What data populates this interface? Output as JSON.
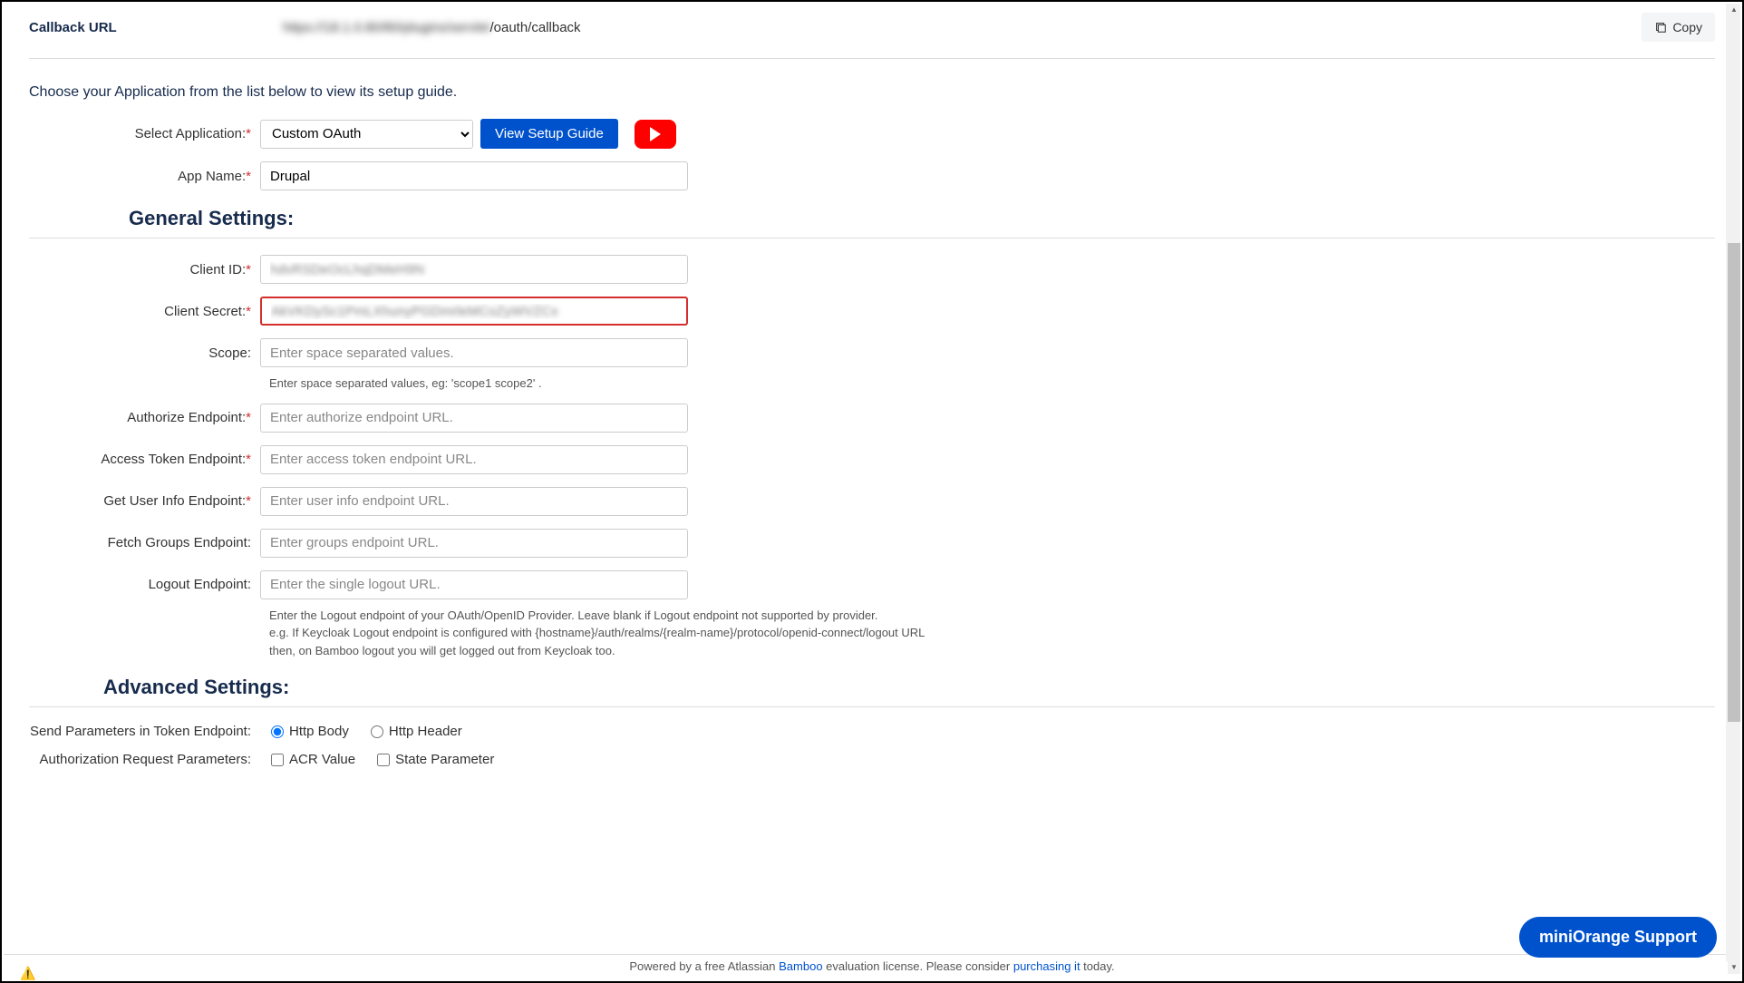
{
  "callback": {
    "label": "Callback URL",
    "url_blurred": "https://18.1.0.80/80/plugins/servlet",
    "url_suffix": "/oauth/callback",
    "copy_label": "Copy"
  },
  "intro": "Choose your Application from the list below to view its setup guide.",
  "select_app": {
    "label": "Select Application:",
    "value": "Custom OAuth"
  },
  "view_setup_btn": "View Setup Guide",
  "app_name": {
    "label": "App Name:",
    "value": "Drupal"
  },
  "general_heading": "General Settings:",
  "client_id": {
    "label": "Client ID:",
    "value": "hdvRSDeOcLhqDMeH9N"
  },
  "client_secret": {
    "label": "Client Secret:",
    "value": "AkVKDySc1PmLXhunyPGDmrleMCoZyWVZCx"
  },
  "scope": {
    "label": "Scope:",
    "placeholder": "Enter space separated values.",
    "help": "Enter space separated values, eg: 'scope1 scope2' ."
  },
  "authorize": {
    "label": "Authorize Endpoint:",
    "placeholder": "Enter authorize endpoint URL."
  },
  "access_token": {
    "label": "Access Token Endpoint:",
    "placeholder": "Enter access token endpoint URL."
  },
  "user_info": {
    "label": "Get User Info Endpoint:",
    "placeholder": "Enter user info endpoint URL."
  },
  "fetch_groups": {
    "label": "Fetch Groups Endpoint:",
    "placeholder": "Enter groups endpoint URL."
  },
  "logout": {
    "label": "Logout Endpoint:",
    "placeholder": "Enter the single logout URL.",
    "help1": "Enter the Logout endpoint of your OAuth/OpenID Provider. Leave blank if Logout endpoint not supported by provider.",
    "help2": "e.g. If Keycloak Logout endpoint is configured with {hostname}/auth/realms/{realm-name}/protocol/openid-connect/logout URL",
    "help3": "then, on Bamboo logout you will get logged out from Keycloak too."
  },
  "advanced_heading": "Advanced Settings:",
  "send_params": {
    "label": "Send Parameters in Token Endpoint:",
    "option1": "Http Body",
    "option2": "Http Header"
  },
  "auth_request": {
    "label": "Authorization Request Parameters:",
    "option1": "ACR Value",
    "option2": "State Parameter"
  },
  "footer": {
    "prefix": "Powered by a free Atlassian ",
    "bamboo": "Bamboo",
    "middle": " evaluation license. Please consider ",
    "purchase": "purchasing it",
    "suffix": " today."
  },
  "support_btn": "miniOrange Support"
}
